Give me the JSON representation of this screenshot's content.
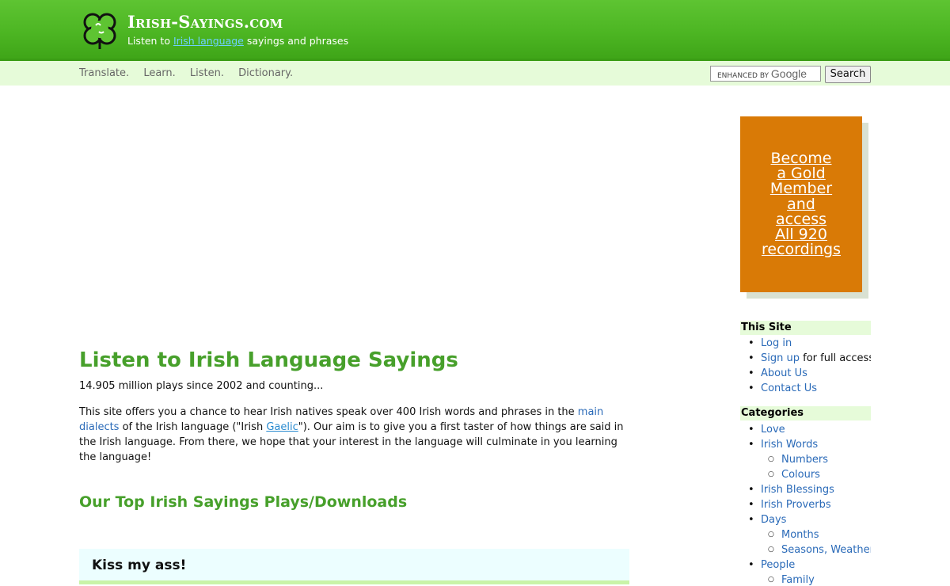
{
  "header": {
    "site_title": "Irish-Sayings.com",
    "tagline_prefix": "Listen to ",
    "tagline_link": "Irish language",
    "tagline_suffix": " sayings and phrases",
    "logo_icon": "shamrock-icon",
    "colors": {
      "header_green": "#4db623",
      "nav_bg": "#e6fbd9"
    }
  },
  "nav": {
    "items": [
      "Translate.",
      "Learn.",
      "Listen.",
      "Dictionary."
    ]
  },
  "search": {
    "enhanced_by": "ENHANCED BY",
    "google": "Google",
    "button_label": "Search"
  },
  "main": {
    "title": "Listen to Irish Language Sayings",
    "plays_text": "14.905 million plays since 2002 and counting...",
    "intro": {
      "p1": "This site offers you a chance to hear Irish natives speak over 400 Irish words and phrases in the ",
      "link_dialects": "main dialects",
      "p2": " of the Irish language (\"Irish ",
      "link_gaelic": "Gaelic",
      "p3": "\"). Our aim is to give you a first taster of how things are said in the Irish language. From there, we hope that your interest in the language will culminate in you learning the language!"
    },
    "top_title": "Our Top Irish Sayings Plays/Downloads",
    "first_saying": "Kiss my ass!"
  },
  "sidebar": {
    "gold_lines": [
      "Become",
      "a Gold",
      "Member",
      "and",
      "access",
      "All 920",
      "recordings"
    ],
    "gold_color": "#d97a06",
    "this_site_heading": "This Site",
    "this_site": {
      "login": "Log in",
      "signup": "Sign up",
      "signup_rest": " for full access",
      "about": "About Us",
      "contact": "Contact Us"
    },
    "categories_heading": "Categories",
    "categories": {
      "love": "Love",
      "irish_words": "Irish Words",
      "numbers": "Numbers",
      "colours": "Colours",
      "blessings": "Irish Blessings",
      "proverbs": "Irish Proverbs",
      "days": "Days",
      "months": "Months",
      "seasons": "Seasons, Weather",
      "people": "People",
      "family": "Family"
    }
  }
}
